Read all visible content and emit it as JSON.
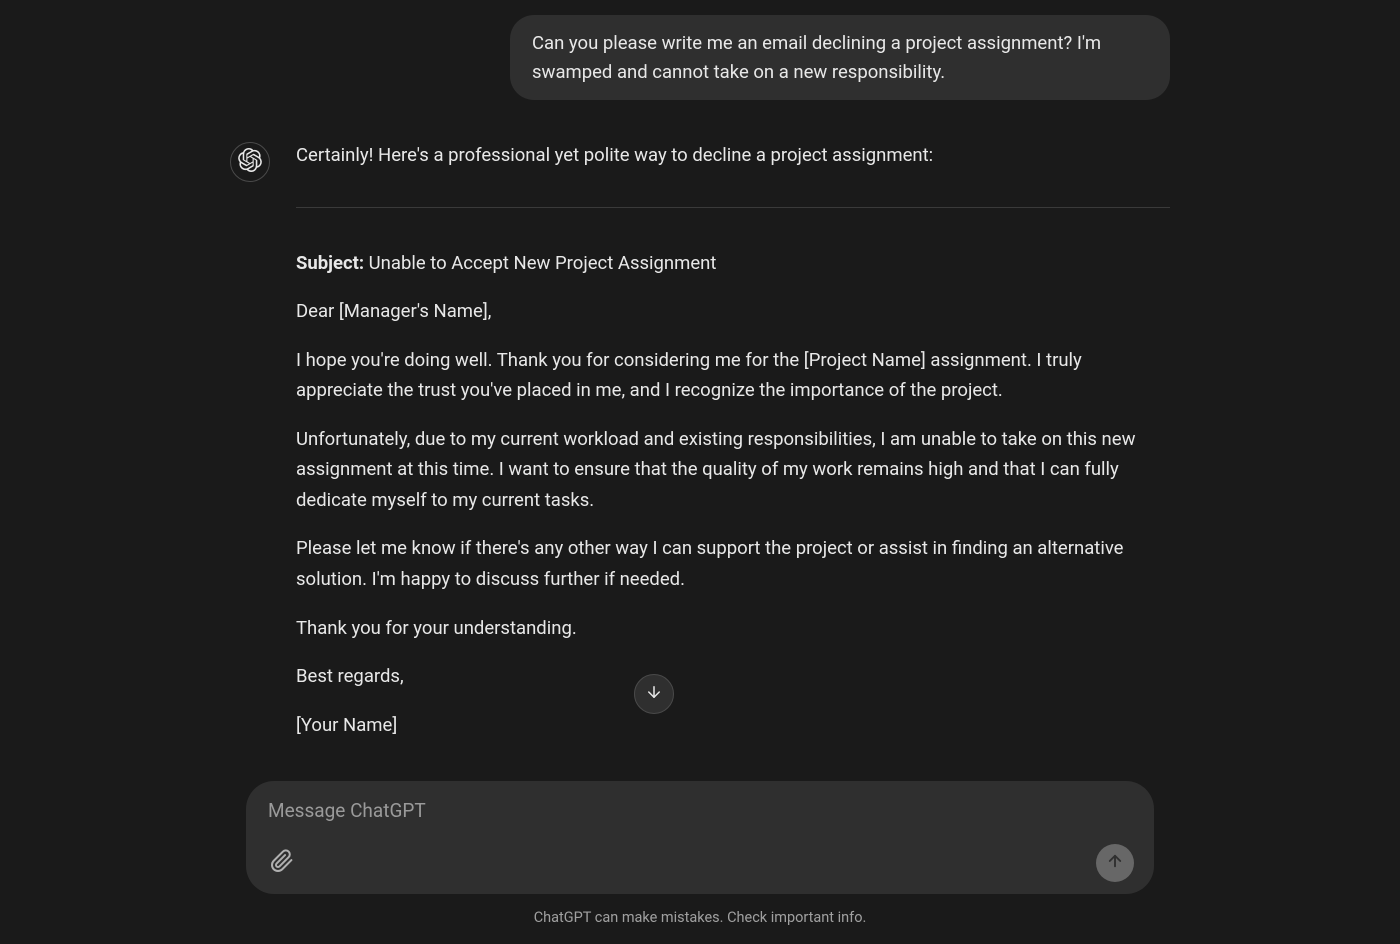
{
  "user_message": "Can you please write me an email declining a project assignment? I'm swamped and cannot take on a new responsibility.",
  "assistant": {
    "intro": "Certainly! Here's a professional yet polite way to decline a project assignment:",
    "email": {
      "subject_label": "Subject:",
      "subject_value": " Unable to Accept New Project Assignment",
      "greeting": "Dear [Manager's Name],",
      "para1": "I hope you're doing well. Thank you for considering me for the [Project Name] assignment. I truly appreciate the trust you've placed in me, and I recognize the importance of the project.",
      "para2": "Unfortunately, due to my current workload and existing responsibilities, I am unable to take on this new assignment at this time. I want to ensure that the quality of my work remains high and that I can fully dedicate myself to my current tasks.",
      "para3": "Please let me know if there's any other way I can support the project or assist in finding an alternative solution. I'm happy to discuss further if needed.",
      "thanks": "Thank you for your understanding.",
      "signoff": "Best regards,",
      "name_placeholder": "[Your Name]"
    }
  },
  "composer": {
    "placeholder": "Message ChatGPT"
  },
  "disclaimer": "ChatGPT can make mistakes. Check important info."
}
